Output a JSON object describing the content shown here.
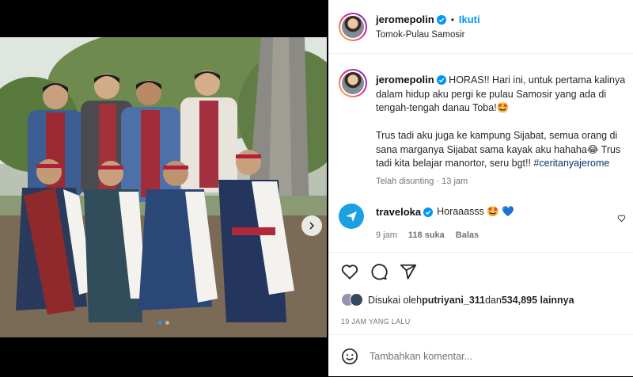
{
  "post": {
    "username": "jeromepolin",
    "follow_label": "Ikuti",
    "separator": "•",
    "location": "Tomok-Pulau Samosir"
  },
  "caption": {
    "username": "jeromepolin",
    "text": "HORAS!! Hari ini, untuk pertama kalinya dalam hidup aku pergi ke pulau Samosir yang ada di tengah-tengah danau Toba!🤩\n\nTrus tadi aku juga ke kampung Sijabat, semua orang di sana marganya Sijabat sama kayak aku hahaha😂 Trus tadi kita belajar manortor, seru bgt!! ",
    "hashtag": "#ceritanyajerome",
    "time": "Telah disunting · 13 jam"
  },
  "comment": {
    "username": "traveloka",
    "text": "Horaaasss 🤩 💙",
    "time": "9 jam",
    "likes": "118 suka",
    "reply_label": "Balas"
  },
  "likes": {
    "prefix": "Disukai oleh ",
    "user": "putriyani_311",
    "middle": " dan ",
    "count": "534,895 lainnya"
  },
  "date": "19 JAM YANG LALU",
  "add_comment": {
    "placeholder": "Tambahkan komentar..."
  },
  "colors": {
    "link": "#0095f6",
    "verified": "#0095f6",
    "muted": "#737373"
  }
}
